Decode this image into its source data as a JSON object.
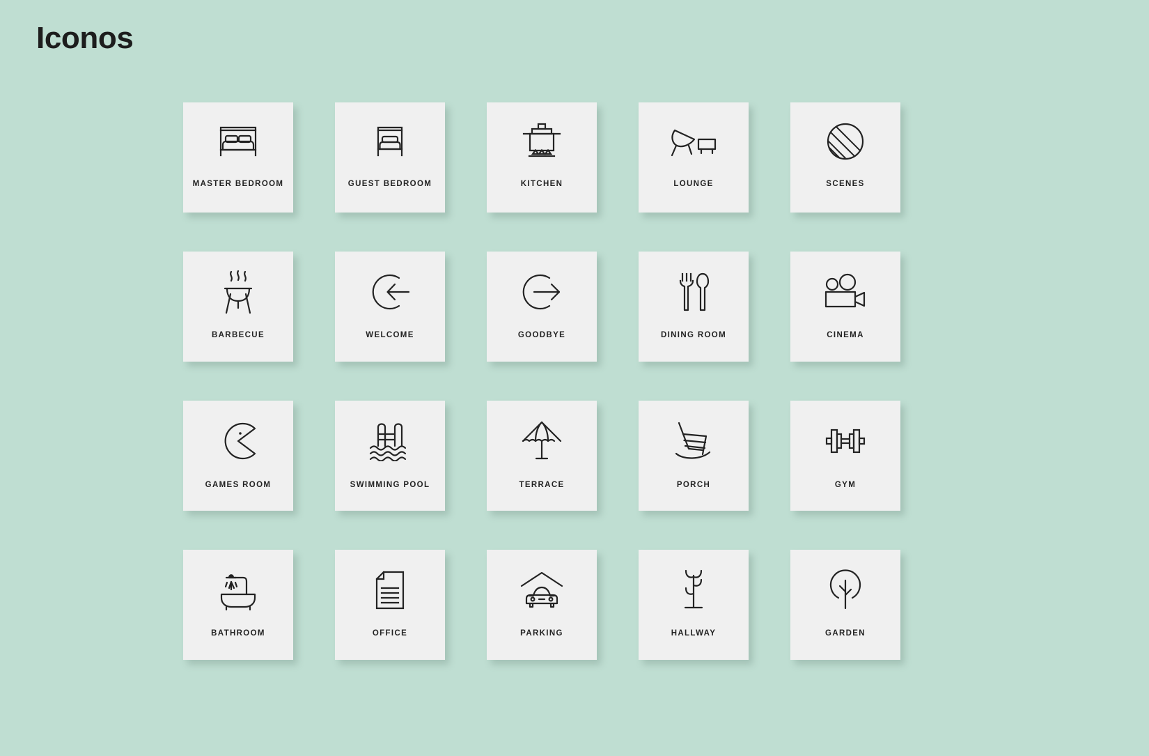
{
  "page": {
    "title": "Iconos",
    "background_color": "#bfded2",
    "card_color": "#f0f0f0",
    "icon_color": "#232323",
    "text_color": "#1d1d1d"
  },
  "grid": {
    "columns": 5,
    "rows": 4,
    "count": 20,
    "items": [
      {
        "label": "MASTER BEDROOM",
        "icon": "double-bed-icon"
      },
      {
        "label": "GUEST BEDROOM",
        "icon": "single-bed-icon"
      },
      {
        "label": "KITCHEN",
        "icon": "cooking-pot-icon"
      },
      {
        "label": "LOUNGE",
        "icon": "lounge-chair-table-icon"
      },
      {
        "label": "SCENES",
        "icon": "striped-circle-icon"
      },
      {
        "label": "BARBECUE",
        "icon": "grill-icon"
      },
      {
        "label": "WELCOME",
        "icon": "arrow-in-circle-icon"
      },
      {
        "label": "GOODBYE",
        "icon": "arrow-out-circle-icon"
      },
      {
        "label": "DINING ROOM",
        "icon": "fork-spoon-icon"
      },
      {
        "label": "CINEMA",
        "icon": "movie-camera-icon"
      },
      {
        "label": "GAMES ROOM",
        "icon": "pacman-icon"
      },
      {
        "label": "SWIMMING POOL",
        "icon": "pool-ladder-icon"
      },
      {
        "label": "TERRACE",
        "icon": "parasol-icon"
      },
      {
        "label": "PORCH",
        "icon": "rocking-chair-icon"
      },
      {
        "label": "GYM",
        "icon": "dumbbell-icon"
      },
      {
        "label": "BATHROOM",
        "icon": "bathtub-shower-icon"
      },
      {
        "label": "OFFICE",
        "icon": "document-icon"
      },
      {
        "label": "PARKING",
        "icon": "car-garage-icon"
      },
      {
        "label": "HALLWAY",
        "icon": "coat-rack-icon"
      },
      {
        "label": "GARDEN",
        "icon": "tree-icon"
      }
    ]
  }
}
